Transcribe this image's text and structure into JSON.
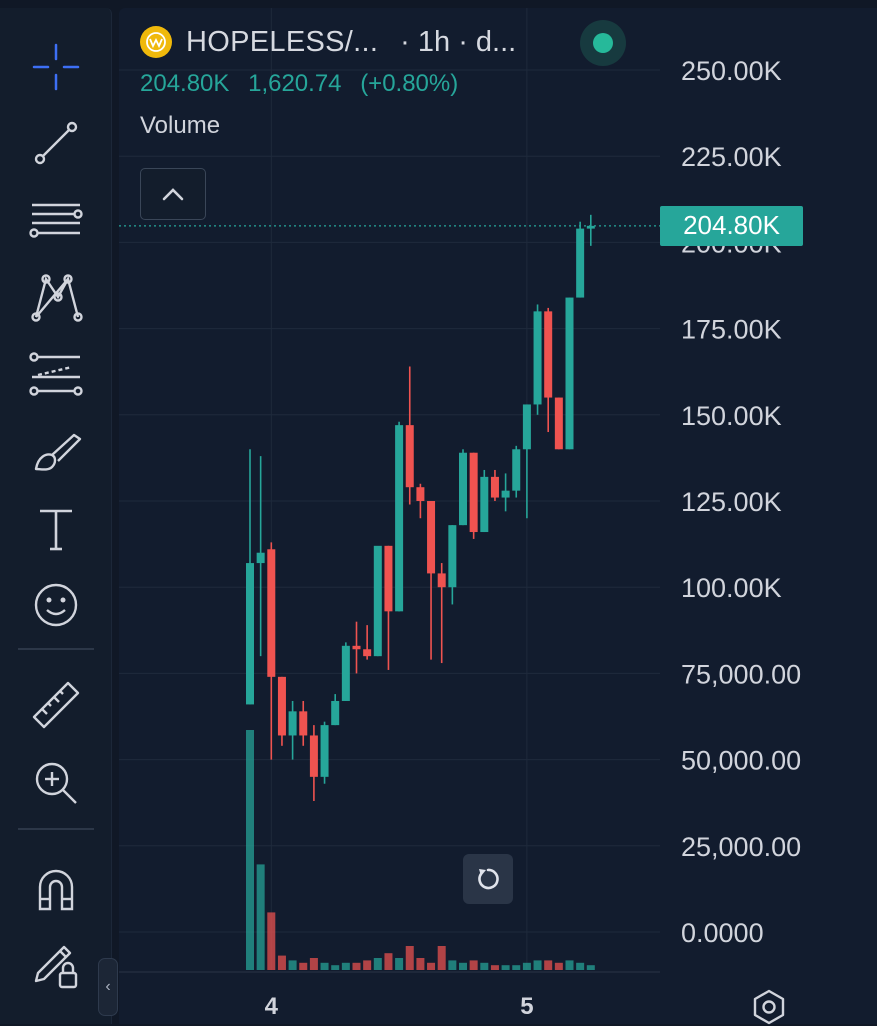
{
  "legend": {
    "symbol": "HOPELESS/...",
    "interval": "· 1h · d...",
    "last_price": "204.80K",
    "change": "1,620.74",
    "change_pct": "(+0.80%)",
    "volume_label": "Volume"
  },
  "price_tag": "204.80K",
  "colors": {
    "up": "#26a69a",
    "down": "#ef5350",
    "accent": "#2962ff",
    "background": "#121c2e"
  },
  "toolbar": {
    "tools": [
      {
        "name": "crosshair-icon",
        "active": true
      },
      {
        "name": "trend-line-icon"
      },
      {
        "name": "horizontal-lines-icon"
      },
      {
        "name": "pattern-icon"
      },
      {
        "name": "prediction-icon"
      },
      {
        "name": "brush-icon"
      },
      {
        "name": "text-tool-icon"
      },
      {
        "name": "emoji-icon"
      },
      {
        "name": "ruler-icon"
      },
      {
        "name": "zoom-in-icon"
      },
      {
        "name": "magnet-icon"
      },
      {
        "name": "lock-drawings-icon"
      }
    ]
  },
  "chart_data": {
    "type": "candlestick",
    "ylim": [
      0,
      250000
    ],
    "y_ticks": [
      {
        "value": 250000,
        "label": "250.00K"
      },
      {
        "value": 225000,
        "label": "225.00K"
      },
      {
        "value": 200000,
        "label": "200.00K"
      },
      {
        "value": 175000,
        "label": "175.00K"
      },
      {
        "value": 150000,
        "label": "150.00K"
      },
      {
        "value": 125000,
        "label": "125.00K"
      },
      {
        "value": 100000,
        "label": "100.00K"
      },
      {
        "value": 75000,
        "label": "75,000.00"
      },
      {
        "value": 50000,
        "label": "50,000.00"
      },
      {
        "value": 25000,
        "label": "25,000.00"
      },
      {
        "value": 0,
        "label": "0.0000"
      }
    ],
    "x_ticks": [
      {
        "index": 2,
        "label": "4"
      },
      {
        "index": 26,
        "label": "5"
      }
    ],
    "last_price": 204800,
    "candles": [
      {
        "o": 66000,
        "h": 140000,
        "l": 66000,
        "c": 107000,
        "v": 100
      },
      {
        "o": 107000,
        "h": 138000,
        "l": 80000,
        "c": 110000,
        "v": 44
      },
      {
        "o": 111000,
        "h": 113000,
        "l": 50000,
        "c": 74000,
        "v": 24
      },
      {
        "o": 74000,
        "h": 74000,
        "l": 54000,
        "c": 57000,
        "v": 6
      },
      {
        "o": 57000,
        "h": 67000,
        "l": 50000,
        "c": 64000,
        "v": 4
      },
      {
        "o": 64000,
        "h": 67000,
        "l": 54000,
        "c": 57000,
        "v": 3
      },
      {
        "o": 57000,
        "h": 60000,
        "l": 38000,
        "c": 45000,
        "v": 5
      },
      {
        "o": 45000,
        "h": 61000,
        "l": 43000,
        "c": 60000,
        "v": 3
      },
      {
        "o": 60000,
        "h": 69000,
        "l": 60000,
        "c": 67000,
        "v": 2
      },
      {
        "o": 67000,
        "h": 84000,
        "l": 67000,
        "c": 83000,
        "v": 3
      },
      {
        "o": 83000,
        "h": 90000,
        "l": 75000,
        "c": 82000,
        "v": 3
      },
      {
        "o": 82000,
        "h": 89000,
        "l": 79000,
        "c": 80000,
        "v": 4
      },
      {
        "o": 80000,
        "h": 90000,
        "l": 80000,
        "c": 112000,
        "v": 5
      },
      {
        "o": 112000,
        "h": 112000,
        "l": 76000,
        "c": 93000,
        "v": 7
      },
      {
        "o": 93000,
        "h": 148000,
        "l": 93000,
        "c": 147000,
        "v": 5
      },
      {
        "o": 147000,
        "h": 164000,
        "l": 124000,
        "c": 129000,
        "v": 10
      },
      {
        "o": 129000,
        "h": 130000,
        "l": 120000,
        "c": 125000,
        "v": 5
      },
      {
        "o": 125000,
        "h": 125000,
        "l": 79000,
        "c": 104000,
        "v": 3
      },
      {
        "o": 104000,
        "h": 107000,
        "l": 78000,
        "c": 100000,
        "v": 10
      },
      {
        "o": 100000,
        "h": 118000,
        "l": 95000,
        "c": 118000,
        "v": 4
      },
      {
        "o": 118000,
        "h": 140000,
        "l": 118000,
        "c": 139000,
        "v": 3
      },
      {
        "o": 139000,
        "h": 139000,
        "l": 114000,
        "c": 116000,
        "v": 4
      },
      {
        "o": 116000,
        "h": 134000,
        "l": 116000,
        "c": 132000,
        "v": 3
      },
      {
        "o": 132000,
        "h": 134000,
        "l": 125000,
        "c": 126000,
        "v": 2
      },
      {
        "o": 126000,
        "h": 133000,
        "l": 122000,
        "c": 128000,
        "v": 2
      },
      {
        "o": 128000,
        "h": 141000,
        "l": 126000,
        "c": 140000,
        "v": 2
      },
      {
        "o": 140000,
        "h": 153000,
        "l": 120000,
        "c": 153000,
        "v": 3
      },
      {
        "o": 153000,
        "h": 182000,
        "l": 150000,
        "c": 180000,
        "v": 4
      },
      {
        "o": 180000,
        "h": 181000,
        "l": 145000,
        "c": 155000,
        "v": 4
      },
      {
        "o": 155000,
        "h": 155000,
        "l": 140000,
        "c": 140000,
        "v": 3
      },
      {
        "o": 140000,
        "h": 184000,
        "l": 140000,
        "c": 184000,
        "v": 4
      },
      {
        "o": 184000,
        "h": 206000,
        "l": 184000,
        "c": 204000,
        "v": 3
      },
      {
        "o": 204000,
        "h": 208000,
        "l": 199000,
        "c": 204800,
        "v": 2
      }
    ]
  }
}
